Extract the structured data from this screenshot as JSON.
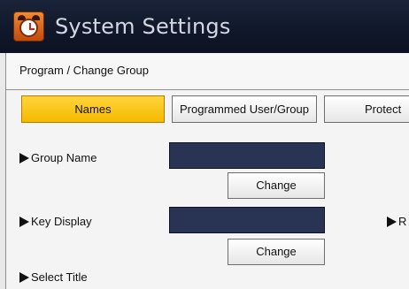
{
  "window": {
    "title": "System Settings",
    "icon": "alarm-clock-icon"
  },
  "breadcrumb": "Program / Change Group",
  "tabs": [
    {
      "label": "Names",
      "active": true
    },
    {
      "label": "Programmed User/Group",
      "active": false
    },
    {
      "label": "Protect",
      "active": false
    }
  ],
  "fields": {
    "group_name": {
      "label": "Group Name",
      "value": "",
      "button": "Change"
    },
    "key_display": {
      "label": "Key Display",
      "value": "",
      "button": "Change"
    },
    "select_title": {
      "label": "Select Title"
    },
    "right_cut_label": "R"
  },
  "colors": {
    "title_bar": "#131b30",
    "active_tab": "#ffc91a",
    "field_fill": "#293454"
  }
}
